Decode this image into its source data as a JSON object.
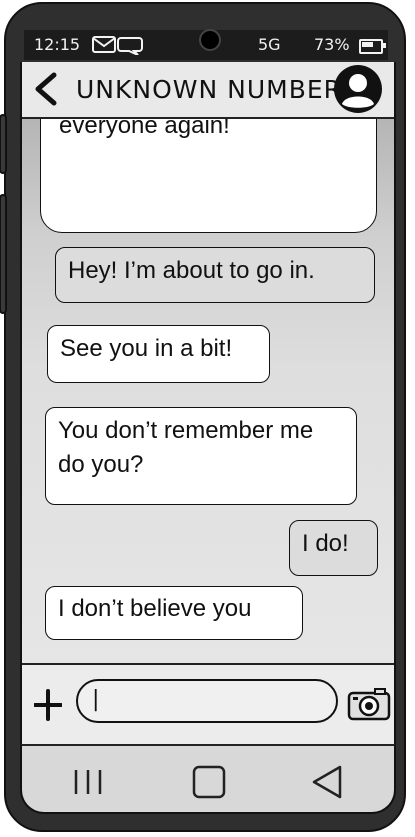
{
  "status_bar": {
    "time": "12:15",
    "signal": "5G",
    "battery": "73%",
    "icons": [
      "mail-icon",
      "message-icon",
      "battery-icon"
    ]
  },
  "header": {
    "back_icon": "chevron-left-icon",
    "contact_name": "UNKNOWN NUMBER",
    "avatar_icon": "user-avatar-icon"
  },
  "messages": [
    {
      "direction": "incoming",
      "text": "Hi! Are you going to the reunion too? I'm already here and I'm excited to see everyone again!"
    },
    {
      "direction": "outgoing",
      "text": "Hey! I’m about to go in."
    },
    {
      "direction": "incoming",
      "text": "See you in a bit!"
    },
    {
      "direction": "incoming",
      "text": "You don’t remember me do you?"
    },
    {
      "direction": "outgoing",
      "text": "I do!"
    },
    {
      "direction": "incoming",
      "text": "I don’t believe you"
    }
  ],
  "input_bar": {
    "plus_icon": "plus-icon",
    "value": "|",
    "camera_icon": "camera-icon"
  },
  "nav_bar": {
    "icons": [
      "recent-apps-icon",
      "home-icon",
      "back-triangle-icon"
    ]
  },
  "colors": {
    "phone_frame": "#2f2f2f",
    "incoming_bubble": "#ffffff",
    "outgoing_bubble": "#dcdcdc",
    "header_bg": "#e9e9e9"
  }
}
